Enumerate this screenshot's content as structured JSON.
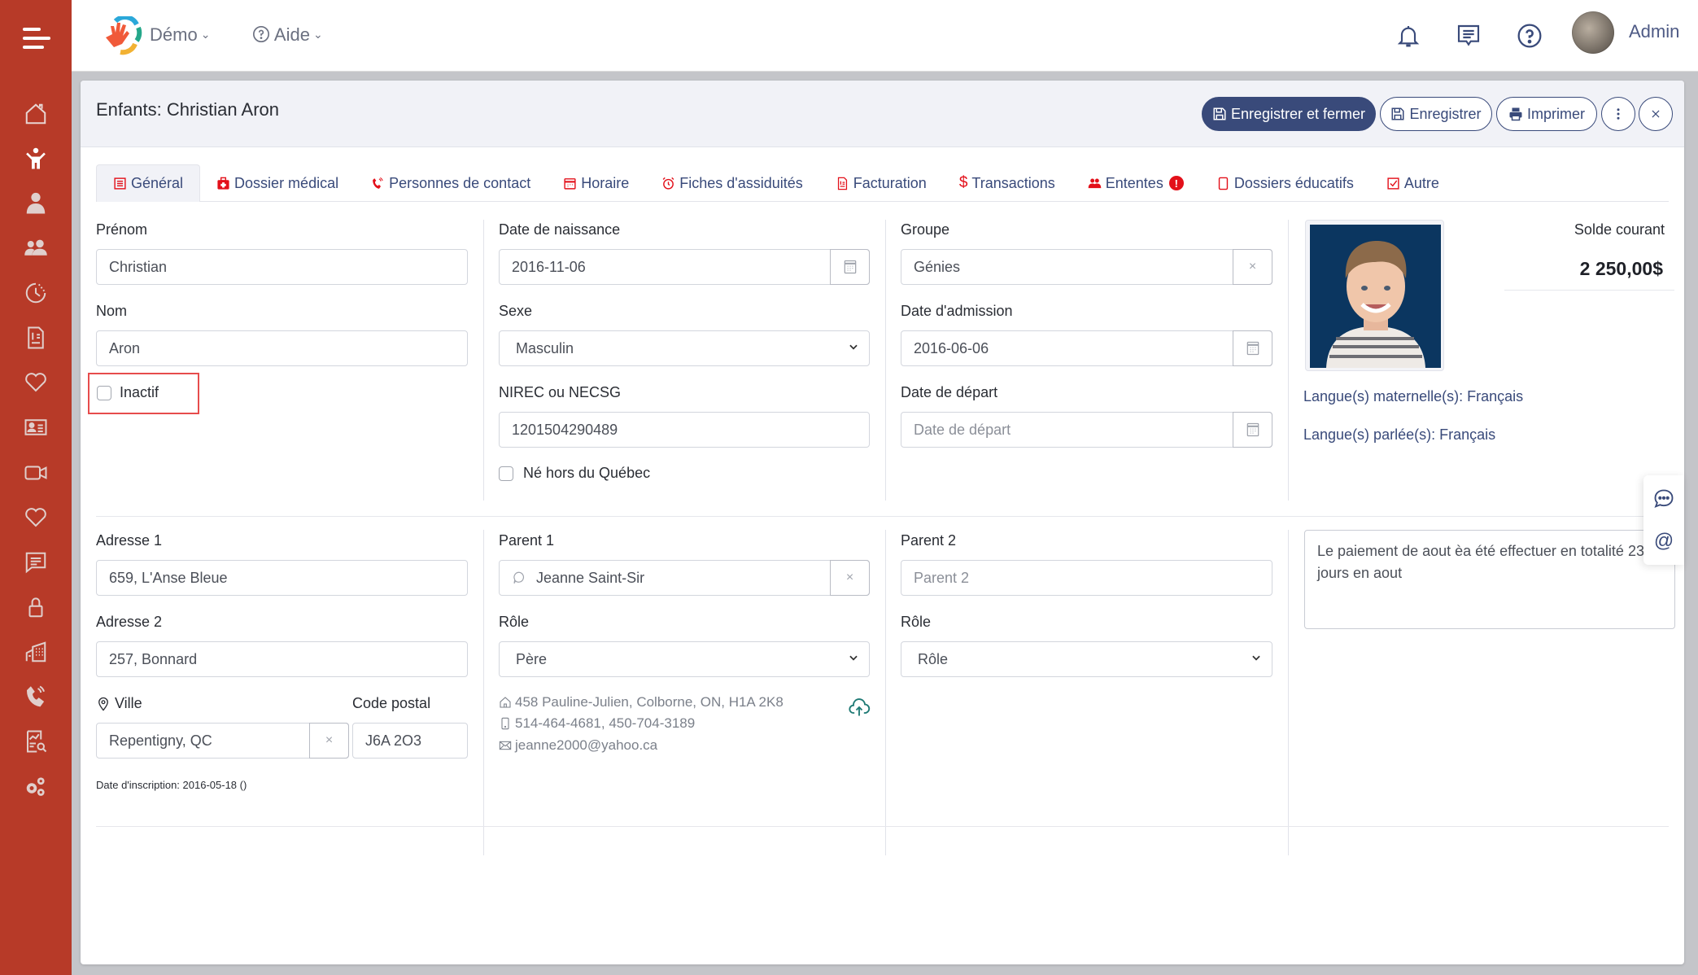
{
  "topbar": {
    "org_menu": "Démo",
    "help_menu": "Aide",
    "user_name": "Admin",
    "icons": [
      "bell-icon",
      "message-icon",
      "help-icon"
    ]
  },
  "sidebar": {
    "items": [
      {
        "name": "home",
        "icon": "home-icon"
      },
      {
        "name": "children",
        "icon": "child-icon",
        "active": true
      },
      {
        "name": "staff",
        "icon": "person-icon"
      },
      {
        "name": "parents",
        "icon": "group-icon"
      },
      {
        "name": "attendance",
        "icon": "clock-icon"
      },
      {
        "name": "billing",
        "icon": "invoice-icon"
      },
      {
        "name": "health",
        "icon": "heart-icon"
      },
      {
        "name": "contacts",
        "icon": "id-card-icon"
      },
      {
        "name": "video",
        "icon": "video-icon"
      },
      {
        "name": "favorites",
        "icon": "heart-icon"
      },
      {
        "name": "messages",
        "icon": "chat-icon"
      },
      {
        "name": "security",
        "icon": "lock-icon"
      },
      {
        "name": "buildings",
        "icon": "building-icon"
      },
      {
        "name": "calls",
        "icon": "phone-icon"
      },
      {
        "name": "reports",
        "icon": "report-icon"
      },
      {
        "name": "settings",
        "icon": "gears-icon"
      }
    ]
  },
  "header": {
    "title": "Enfants: Christian Aron",
    "save_close_label": "Enregistrer et fermer",
    "save_label": "Enregistrer",
    "print_label": "Imprimer"
  },
  "tabs": [
    {
      "label": "Général",
      "icon": "document-icon",
      "active": true
    },
    {
      "label": "Dossier médical",
      "icon": "medical-kit-icon"
    },
    {
      "label": "Personnes de contact",
      "icon": "phone-ring-icon"
    },
    {
      "label": "Horaire",
      "icon": "calendar-icon"
    },
    {
      "label": "Fiches d'assiduités",
      "icon": "alarm-icon"
    },
    {
      "label": "Facturation",
      "icon": "invoice-icon"
    },
    {
      "label": "Transactions",
      "icon": "dollar-icon"
    },
    {
      "label": "Ententes",
      "icon": "users-icon",
      "badge": "!"
    },
    {
      "label": "Dossiers éducatifs",
      "icon": "tablet-icon"
    },
    {
      "label": "Autre",
      "icon": "checkbox-icon"
    }
  ],
  "form": {
    "first_name": {
      "label": "Prénom",
      "value": "Christian"
    },
    "last_name": {
      "label": "Nom",
      "value": "Aron"
    },
    "inactive": {
      "label": "Inactif",
      "checked": false
    },
    "birth_date": {
      "label": "Date de naissance",
      "value": "2016-11-06"
    },
    "sex": {
      "label": "Sexe",
      "value": "Masculin"
    },
    "nirec": {
      "label": "NIREC ou NECSG",
      "value": "1201504290489"
    },
    "born_outside": {
      "label": "Né hors du Québec",
      "checked": false
    },
    "group": {
      "label": "Groupe",
      "value": "Génies"
    },
    "admission_date": {
      "label": "Date d'admission",
      "value": "2016-06-06"
    },
    "departure_date": {
      "label": "Date de départ",
      "placeholder": "Date de départ"
    },
    "balance": {
      "label": "Solde courant",
      "value": "2 250,00$"
    },
    "mother_tongue": "Langue(s) maternelle(s): Français",
    "spoken_language": "Langue(s) parlée(s): Français",
    "address1": {
      "label": "Adresse 1",
      "value": "659, L'Anse Bleue"
    },
    "address2": {
      "label": "Adresse 2",
      "value": "257, Bonnard"
    },
    "city": {
      "label": "Ville",
      "value": "Repentigny, QC"
    },
    "postal_code": {
      "label": "Code postal",
      "value": "J6A 2O3"
    },
    "registration_date": "Date d'inscription: 2016-05-18 ()",
    "parent1": {
      "label": "Parent 1",
      "value": "Jeanne Saint-Sir",
      "role_label": "Rôle",
      "role_value": "Père",
      "address": "458 Pauline-Julien, Colborne, ON, H1A 2K8",
      "phones": "514-464-4681, 450-704-3189",
      "email": "jeanne2000@yahoo.ca"
    },
    "parent2": {
      "label": "Parent 2",
      "placeholder": "Parent 2",
      "role_label": "Rôle",
      "role_value": "Rôle"
    },
    "notes": "Le paiement de aout èa été effectuer en totalité 23 jours en aout"
  },
  "colors": {
    "sidebar": "#b73a28",
    "primary": "#394a7a",
    "tab_icon": "#e3101a",
    "highlight": "#e74c4c"
  }
}
